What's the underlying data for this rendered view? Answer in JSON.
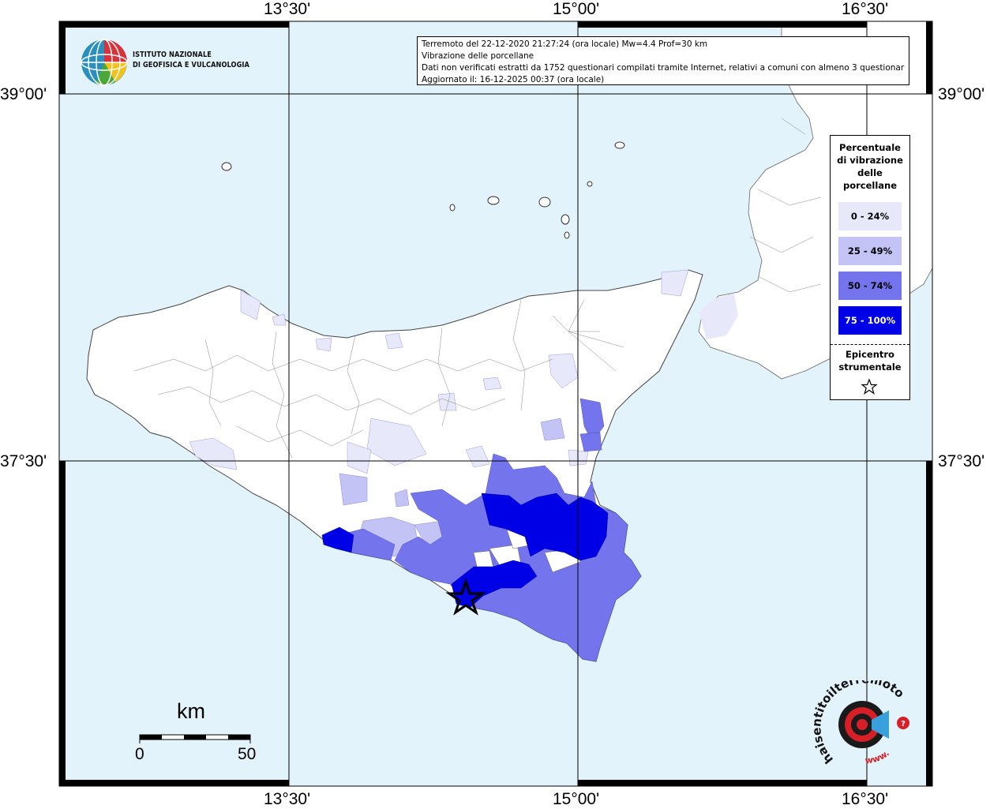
{
  "title_box": {
    "line1": "Terremoto del 22-12-2020 21:27:24 (ora locale) Mw=4.4 Prof=30 km",
    "line2": "Vibrazione delle porcellane",
    "line3": "Dati non verificati estratti da 1752 questionari compilati tramite Internet, relativi a comuni con almeno 3 questionari.",
    "line4": "Aggiornato il: 16-12-2025 00:37 (ora locale)"
  },
  "ingv_logo": {
    "line1": "ISTITUTO NAZIONALE",
    "line2": "DI GEOFISICA E VULCANOLOGIA"
  },
  "axis_labels": {
    "lon_top": [
      "13°30'",
      "15°00'",
      "16°30'"
    ],
    "lon_bottom": [
      "13°30'",
      "15°00'",
      "16°30'"
    ],
    "lat_left": [
      "39°00'",
      "37°30'"
    ],
    "lat_right": [
      "39°00'",
      "37°30'"
    ]
  },
  "legend": {
    "title": "Percentuale di vibrazione delle porcellane",
    "items": [
      {
        "label": "0 - 24%",
        "color": "#e8e8fb"
      },
      {
        "label": "25 - 49%",
        "color": "#c3c3f5"
      },
      {
        "label": "50 - 74%",
        "color": "#7474ec"
      },
      {
        "label": "75 - 100%",
        "color": "#0000e6"
      }
    ],
    "epicenter_label": "Epicentro strumentale"
  },
  "scale": {
    "unit": "km",
    "min": "0",
    "max": "50"
  },
  "colors": {
    "sea": "#e2f3fc",
    "land": "#ffffff",
    "frame": "#000000"
  },
  "epicenter_icon": "star-icon",
  "hst_logo": {
    "text": "haisentitoilterremoto.it",
    "subtext": "www.",
    "icon": "target-megaphone-icon"
  }
}
